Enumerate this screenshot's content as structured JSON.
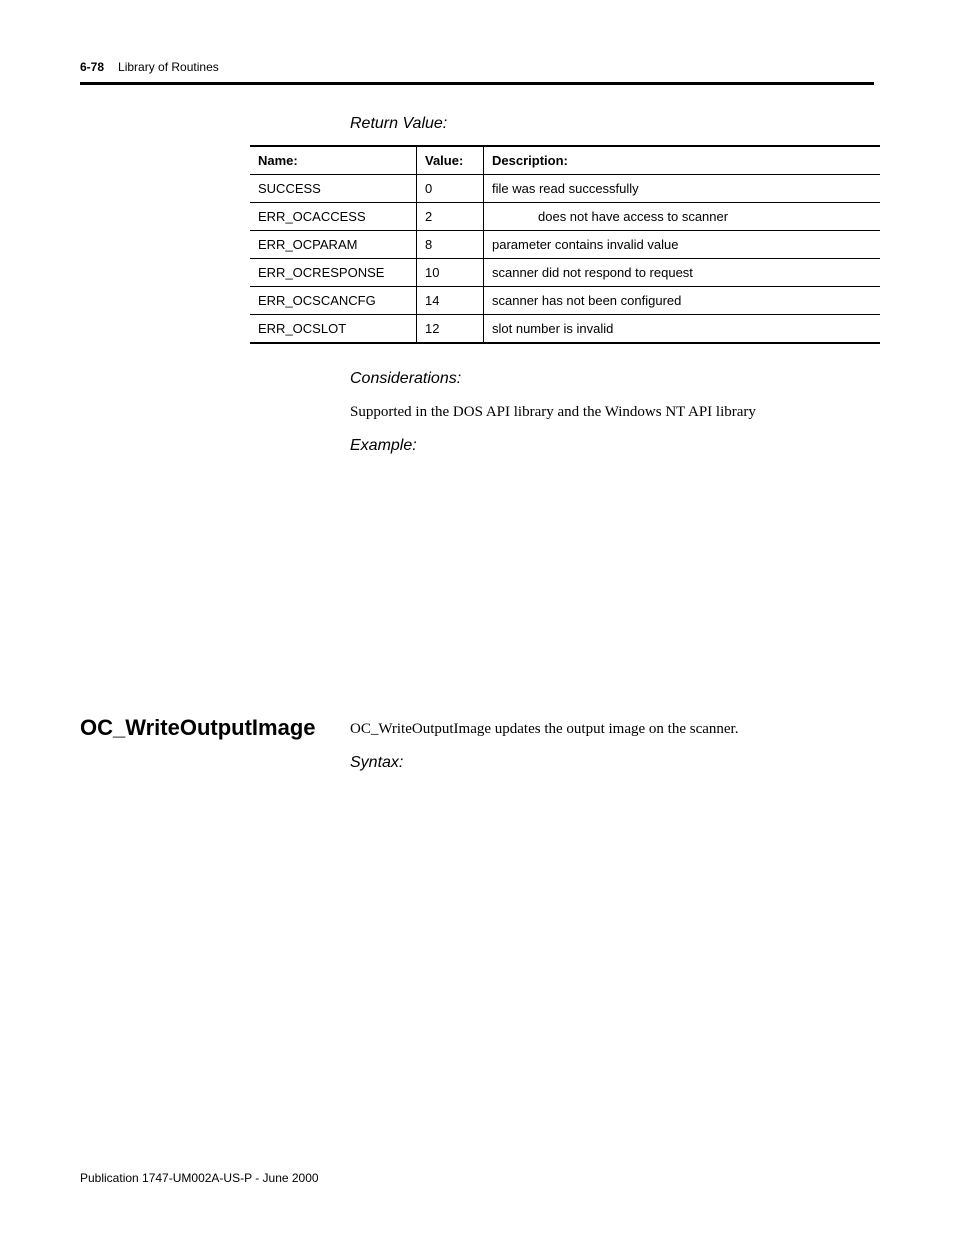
{
  "header": {
    "page": "6-78",
    "chapter": "Library of Routines"
  },
  "returnValue": {
    "heading": "Return Value:",
    "columns": {
      "name": "Name:",
      "value": "Value:",
      "desc": "Description:"
    },
    "rows": [
      {
        "name": "SUCCESS",
        "value": "0",
        "desc": "file was read successfully"
      },
      {
        "name": "ERR_OCACCESS",
        "value": "2",
        "desc": "does not have access to scanner",
        "indent": true
      },
      {
        "name": "ERR_OCPARAM",
        "value": "8",
        "desc": "parameter contains invalid value"
      },
      {
        "name": "ERR_OCRESPONSE",
        "value": "10",
        "desc": "scanner did not respond to request"
      },
      {
        "name": "ERR_OCSCANCFG",
        "value": "14",
        "desc": "scanner has not been configured"
      },
      {
        "name": "ERR_OCSLOT",
        "value": "12",
        "desc": "slot number is invalid"
      }
    ]
  },
  "considerations": {
    "heading": "Considerations:",
    "body": "Supported in the DOS API library and the Windows NT API library"
  },
  "example": {
    "heading": "Example:"
  },
  "section": {
    "title": "OC_WriteOutputImage",
    "body": "OC_WriteOutputImage updates the output image on the scanner.",
    "syntax": "Syntax:"
  },
  "footer": "Publication 1747-UM002A-US-P - June 2000"
}
